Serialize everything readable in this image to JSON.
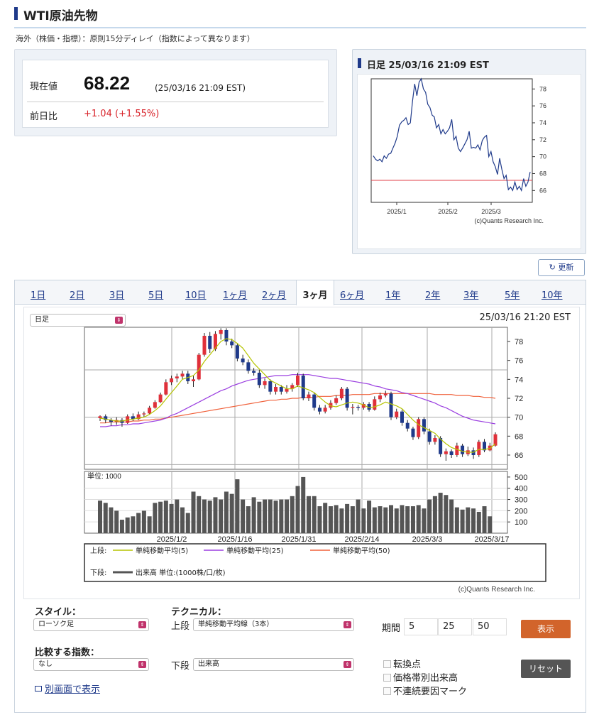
{
  "header": {
    "title": "WTI原油先物",
    "note": "海外（株価・指標）：原則15分ディレイ（指数によって異なります）"
  },
  "quote": {
    "current_label": "現在値",
    "current_value": "68.22",
    "current_time": "(25/03/16 21:09 EST)",
    "change_label": "前日比",
    "change_value": "+1.04 (+1.55%)",
    "change_color": "#d8232a"
  },
  "mini_chart": {
    "title": "日足 25/03/16 21:09 EST",
    "credit": "(c)Quants Research Inc.",
    "x_ticks": [
      "2025/1",
      "2025/2",
      "2025/3"
    ],
    "y_ticks": [
      "78",
      "76",
      "74",
      "72",
      "70",
      "68",
      "66"
    ],
    "line_color": "#1f3a8a",
    "ref_line_color": "#e0404a"
  },
  "refresh_label": "更新",
  "tabs": [
    "1日",
    "2日",
    "3日",
    "5日",
    "10日",
    "1ヶ月",
    "2ヶ月",
    "3ヶ月",
    "6ヶ月",
    "1年",
    "2年",
    "3年",
    "5年",
    "10年"
  ],
  "active_tab": "3ヶ月",
  "chart": {
    "period_select": "日足",
    "timestamp": "25/03/16 21:20 EST",
    "volume_unit": "単位: 1000",
    "credit": "(c)Quants Research Inc.",
    "legend_upper_label": "上段:",
    "legend_lower_label": "下段:",
    "legend_ma5": "単純移動平均(5)",
    "legend_ma25": "単純移動平均(25)",
    "legend_ma50": "単純移動平均(50)",
    "legend_volume": "出来高 単位:(1000株/口/枚)",
    "colors": {
      "up": "#e0303a",
      "down": "#1f3a8a",
      "ma5": "#b5c400",
      "ma25": "#9b3fe0",
      "ma50": "#f0603a",
      "volume": "#555555"
    }
  },
  "chart_data": {
    "type": "candlestick",
    "x_labels": [
      "2025/1/2",
      "2025/1/16",
      "2025/1/31",
      "2025/2/14",
      "2025/3/3",
      "2025/3/17"
    ],
    "price_ylim": [
      64.5,
      79.5
    ],
    "price_ticks": [
      78,
      76,
      74,
      72,
      70,
      68,
      66
    ],
    "volume_ylim": [
      0,
      550
    ],
    "volume_ticks": [
      500,
      400,
      300,
      200,
      100
    ],
    "candles": [
      [
        69.9,
        70.1,
        69.6,
        70.2
      ],
      [
        70.1,
        69.7,
        69.4,
        70.3
      ],
      [
        69.7,
        69.5,
        69.1,
        69.9
      ],
      [
        69.5,
        69.7,
        69.2,
        70.0
      ],
      [
        69.7,
        69.4,
        69.0,
        69.9
      ],
      [
        69.4,
        70.1,
        69.3,
        70.3
      ],
      [
        70.1,
        69.8,
        69.6,
        70.4
      ],
      [
        69.8,
        70.3,
        69.7,
        70.6
      ],
      [
        70.3,
        70.4,
        70.0,
        70.6
      ],
      [
        70.4,
        71.0,
        70.3,
        71.2
      ],
      [
        71.0,
        71.6,
        70.9,
        71.8
      ],
      [
        71.6,
        72.4,
        71.5,
        72.6
      ],
      [
        72.4,
        73.7,
        72.3,
        74.0
      ],
      [
        73.7,
        74.1,
        73.4,
        74.4
      ],
      [
        74.1,
        74.3,
        73.7,
        74.6
      ],
      [
        74.3,
        74.6,
        74.0,
        74.9
      ],
      [
        74.6,
        73.8,
        73.5,
        74.9
      ],
      [
        73.8,
        74.0,
        73.2,
        74.4
      ],
      [
        74.0,
        76.6,
        73.9,
        76.8
      ],
      [
        76.6,
        78.6,
        76.4,
        78.9
      ],
      [
        78.6,
        77.2,
        76.8,
        79.0
      ],
      [
        77.2,
        78.8,
        77.0,
        79.1
      ],
      [
        78.8,
        79.2,
        78.2,
        79.4
      ],
      [
        79.2,
        78.0,
        77.6,
        79.4
      ],
      [
        78.0,
        77.6,
        77.3,
        78.3
      ],
      [
        77.6,
        76.2,
        75.9,
        77.8
      ],
      [
        76.2,
        75.8,
        75.5,
        76.6
      ],
      [
        75.8,
        74.9,
        74.6,
        76.1
      ],
      [
        74.9,
        74.7,
        74.4,
        75.2
      ],
      [
        74.7,
        73.4,
        73.1,
        75.0
      ],
      [
        73.4,
        73.8,
        73.0,
        74.1
      ],
      [
        73.8,
        72.7,
        72.4,
        74.0
      ],
      [
        72.7,
        73.2,
        72.4,
        73.5
      ],
      [
        73.2,
        72.7,
        72.4,
        73.4
      ],
      [
        72.7,
        73.0,
        72.5,
        73.4
      ],
      [
        73.0,
        73.4,
        72.7,
        73.6
      ],
      [
        73.4,
        74.4,
        73.2,
        74.7
      ],
      [
        74.4,
        72.0,
        71.8,
        74.6
      ],
      [
        72.0,
        72.4,
        71.7,
        72.7
      ],
      [
        72.4,
        71.0,
        70.7,
        72.6
      ],
      [
        71.0,
        70.6,
        70.3,
        71.3
      ],
      [
        70.6,
        71.0,
        70.4,
        71.3
      ],
      [
        71.0,
        71.5,
        70.8,
        71.8
      ],
      [
        71.5,
        72.0,
        71.3,
        72.3
      ],
      [
        72.0,
        73.0,
        71.8,
        73.2
      ],
      [
        73.0,
        71.0,
        70.7,
        73.2
      ],
      [
        71.0,
        71.1,
        70.3,
        71.4
      ],
      [
        71.1,
        71.0,
        70.7,
        71.3
      ],
      [
        71.0,
        71.4,
        70.8,
        71.6
      ],
      [
        71.4,
        70.8,
        70.6,
        71.6
      ],
      [
        70.8,
        71.9,
        70.7,
        72.2
      ],
      [
        71.9,
        72.3,
        71.6,
        72.6
      ],
      [
        72.3,
        72.5,
        72.1,
        72.8
      ],
      [
        72.5,
        70.0,
        69.7,
        72.7
      ],
      [
        70.0,
        70.6,
        69.8,
        70.9
      ],
      [
        70.6,
        69.4,
        69.1,
        70.8
      ],
      [
        69.4,
        68.8,
        68.5,
        69.7
      ],
      [
        68.8,
        67.9,
        67.6,
        69.0
      ],
      [
        67.9,
        69.8,
        67.7,
        70.0
      ],
      [
        69.8,
        68.5,
        68.2,
        70.0
      ],
      [
        68.5,
        67.4,
        67.1,
        68.8
      ],
      [
        67.4,
        67.8,
        67.1,
        68.1
      ],
      [
        67.8,
        66.1,
        65.8,
        68.0
      ],
      [
        66.1,
        66.4,
        65.4,
        66.7
      ],
      [
        66.4,
        66.0,
        65.7,
        66.6
      ],
      [
        66.0,
        67.0,
        65.8,
        67.3
      ],
      [
        67.0,
        66.1,
        65.8,
        67.2
      ],
      [
        66.1,
        66.5,
        65.9,
        66.9
      ],
      [
        66.5,
        66.0,
        65.6,
        66.8
      ],
      [
        66.0,
        67.4,
        65.8,
        67.6
      ],
      [
        67.4,
        66.5,
        66.3,
        67.7
      ],
      [
        66.5,
        67.0,
        66.4,
        67.3
      ],
      [
        67.0,
        68.2,
        66.9,
        68.4
      ]
    ],
    "ma5": [
      69.9,
      69.8,
      69.7,
      69.6,
      69.6,
      69.7,
      69.8,
      69.9,
      70.0,
      70.3,
      70.7,
      71.2,
      71.9,
      72.6,
      73.3,
      74.0,
      74.2,
      74.4,
      75.0,
      75.9,
      76.6,
      77.3,
      78.0,
      78.3,
      78.2,
      77.8,
      77.3,
      76.5,
      75.7,
      75.1,
      74.5,
      73.9,
      73.6,
      73.3,
      73.0,
      73.0,
      73.3,
      73.1,
      72.9,
      72.6,
      72.1,
      71.6,
      71.2,
      71.1,
      71.3,
      71.5,
      71.6,
      71.5,
      71.3,
      71.0,
      71.1,
      71.3,
      71.6,
      71.4,
      71.2,
      70.9,
      70.3,
      69.7,
      69.2,
      68.9,
      68.6,
      68.3,
      67.7,
      67.2,
      66.8,
      66.6,
      66.4,
      66.3,
      66.3,
      66.6,
      66.6,
      66.7,
      67.2
    ],
    "ma25": [
      69.0,
      69.0,
      69.1,
      69.1,
      69.2,
      69.2,
      69.3,
      69.3,
      69.4,
      69.5,
      69.6,
      69.7,
      69.9,
      70.2,
      70.4,
      70.7,
      71.0,
      71.3,
      71.6,
      71.9,
      72.2,
      72.5,
      72.8,
      73.0,
      73.3,
      73.5,
      73.7,
      73.9,
      74.0,
      74.1,
      74.2,
      74.3,
      74.4,
      74.4,
      74.4,
      74.5,
      74.5,
      74.5,
      74.5,
      74.4,
      74.3,
      74.2,
      74.1,
      74.1,
      74.0,
      73.9,
      73.8,
      73.7,
      73.6,
      73.5,
      73.3,
      73.2,
      73.0,
      72.9,
      72.8,
      72.6,
      72.5,
      72.3,
      72.1,
      71.9,
      71.7,
      71.5,
      71.2,
      71.0,
      70.7,
      70.4,
      70.1,
      69.9,
      69.7,
      69.6,
      69.5,
      69.4,
      69.3
    ],
    "ma50": [
      69.4,
      69.4,
      69.5,
      69.5,
      69.5,
      69.5,
      69.6,
      69.6,
      69.7,
      69.7,
      69.8,
      69.8,
      69.9,
      70.0,
      70.1,
      70.2,
      70.3,
      70.4,
      70.5,
      70.6,
      70.7,
      70.8,
      70.9,
      71.0,
      71.1,
      71.2,
      71.3,
      71.4,
      71.5,
      71.6,
      71.7,
      71.8,
      71.8,
      71.9,
      71.9,
      72.0,
      72.0,
      72.1,
      72.1,
      72.1,
      72.2,
      72.2,
      72.2,
      72.3,
      72.3,
      72.3,
      72.4,
      72.4,
      72.4,
      72.4,
      72.5,
      72.5,
      72.5,
      72.5,
      72.5,
      72.5,
      72.5,
      72.5,
      72.5,
      72.5,
      72.5,
      72.4,
      72.4,
      72.4,
      72.4,
      72.3,
      72.3,
      72.3,
      72.2,
      72.2,
      72.1,
      72.1,
      72.0
    ],
    "volumes": [
      290,
      270,
      230,
      200,
      120,
      140,
      150,
      180,
      200,
      150,
      270,
      280,
      290,
      260,
      300,
      230,
      180,
      370,
      330,
      300,
      290,
      320,
      300,
      370,
      350,
      480,
      300,
      240,
      320,
      280,
      300,
      300,
      290,
      300,
      300,
      330,
      420,
      500,
      330,
      330,
      240,
      270,
      240,
      250,
      220,
      260,
      240,
      300,
      220,
      290,
      230,
      240,
      230,
      250,
      220,
      250,
      240,
      240,
      250,
      220,
      300,
      330,
      360,
      340,
      300,
      230,
      210,
      230,
      220,
      190,
      240,
      150,
      0
    ]
  },
  "controls": {
    "style_label": "スタイル：",
    "style_value": "ローソク足",
    "technical_label": "テクニカル：",
    "upper_label": "上段",
    "upper_value": "単純移動平均線（3本）",
    "lower_label": "下段",
    "lower_value": "出来高",
    "period_label": "期間",
    "period_values": [
      "5",
      "25",
      "50"
    ],
    "show_button": "表示",
    "reset_button": "リセット",
    "compare_label": "比較する指数：",
    "compare_value": "なし",
    "checkboxes": [
      "転換点",
      "価格帯別出来高",
      "不連続要因マーク"
    ],
    "new_window_link": "別画面で表示"
  }
}
